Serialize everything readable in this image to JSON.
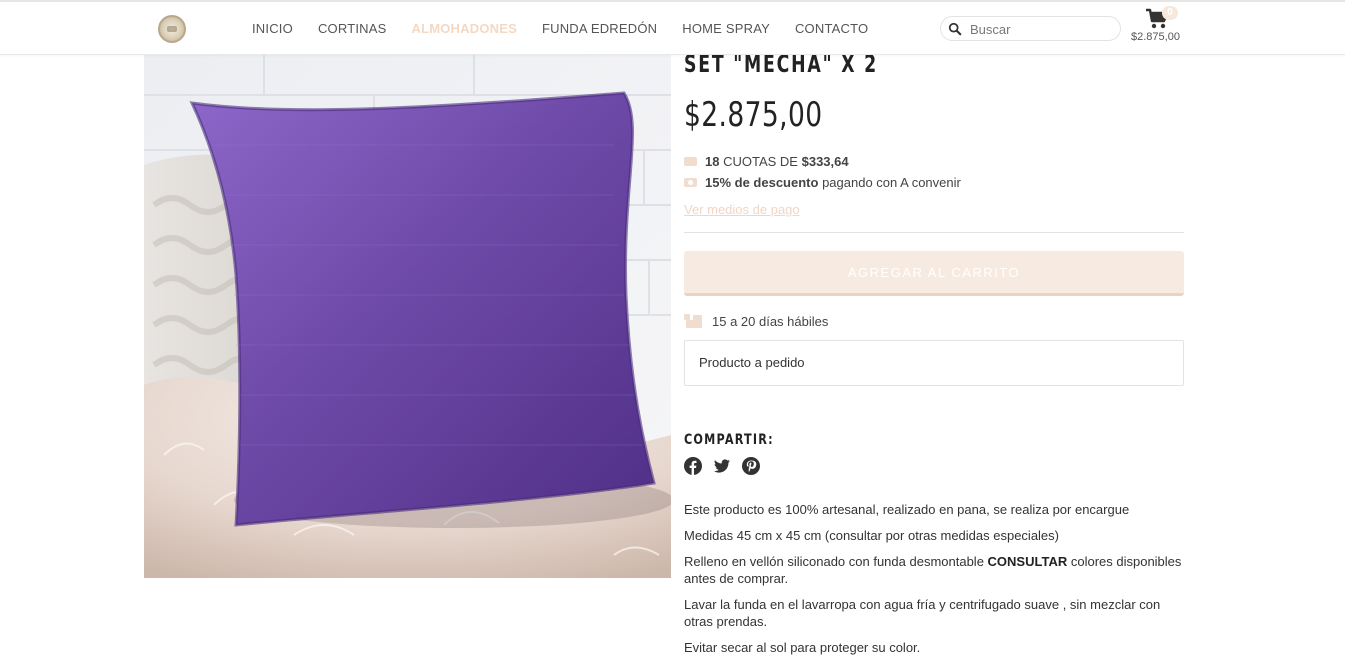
{
  "header": {
    "nav": [
      "INICIO",
      "CORTINAS",
      "ALMOHADONES",
      "FUNDA EDREDÓN",
      "HOME SPRAY",
      "CONTACTO"
    ],
    "active_nav": "ALMOHADONES",
    "search_placeholder": "Buscar",
    "cart_count": "0",
    "cart_total": "$2.875,00"
  },
  "product": {
    "title": "SET \"MECHA\" X 2",
    "price": "$2.875,00",
    "installments_count": "18",
    "installments_text": "CUOTAS DE",
    "installments_amount": "$333,64",
    "discount_bold": "15% de descuento",
    "discount_text": "pagando con A convenir",
    "payment_link": "Ver medios de pago",
    "add_to_cart": "AGREGAR AL CARRITO",
    "shipping_time": "15 a 20 días hábiles",
    "stock_note": "Producto a pedido"
  },
  "share": {
    "title": "COMPARTIR:",
    "icons": [
      "facebook-icon",
      "twitter-icon",
      "pinterest-icon"
    ]
  },
  "description": {
    "p1": "Este producto es 100% artesanal, realizado en pana, se realiza por encargue",
    "p2": "Medidas 45 cm x 45 cm (consultar por otras medidas especiales)",
    "p3_before": "Relleno en vellón siliconado con funda desmontable ",
    "p3_bold": "CONSULTAR",
    "p3_after": " colores disponibles antes de comprar.",
    "p4": "Lavar la funda en el lavarropa con agua fría y centrifugado suave , sin mezclar con otras prendas.",
    "p5": "Evitar secar al sol para proteger su color."
  },
  "colors": {
    "accent": "#f3d9c4",
    "button_bg": "#f7ebe1",
    "text": "#333333"
  }
}
